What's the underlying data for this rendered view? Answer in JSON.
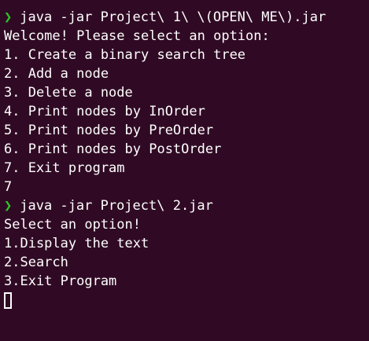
{
  "terminal": {
    "colors": {
      "background": "#300a24",
      "foreground": "#ffffff",
      "prompt": "#2ec427"
    },
    "prompt_symbol": "❯",
    "blocks": [
      {
        "command": "java -jar Project\\ 1\\ \\(OPEN\\ ME\\).jar",
        "output": [
          "Welcome! Please select an option:",
          "1. Create a binary search tree",
          "2. Add a node",
          "3. Delete a node",
          "4. Print nodes by InOrder",
          "5. Print nodes by PreOrder",
          "6. Print nodes by PostOrder",
          "7. Exit program",
          "7"
        ]
      },
      {
        "command": "java -jar Project\\ 2.jar",
        "output": [
          "Select an option!",
          "1.Display the text",
          "2.Search",
          "3.Exit Program"
        ]
      }
    ]
  }
}
